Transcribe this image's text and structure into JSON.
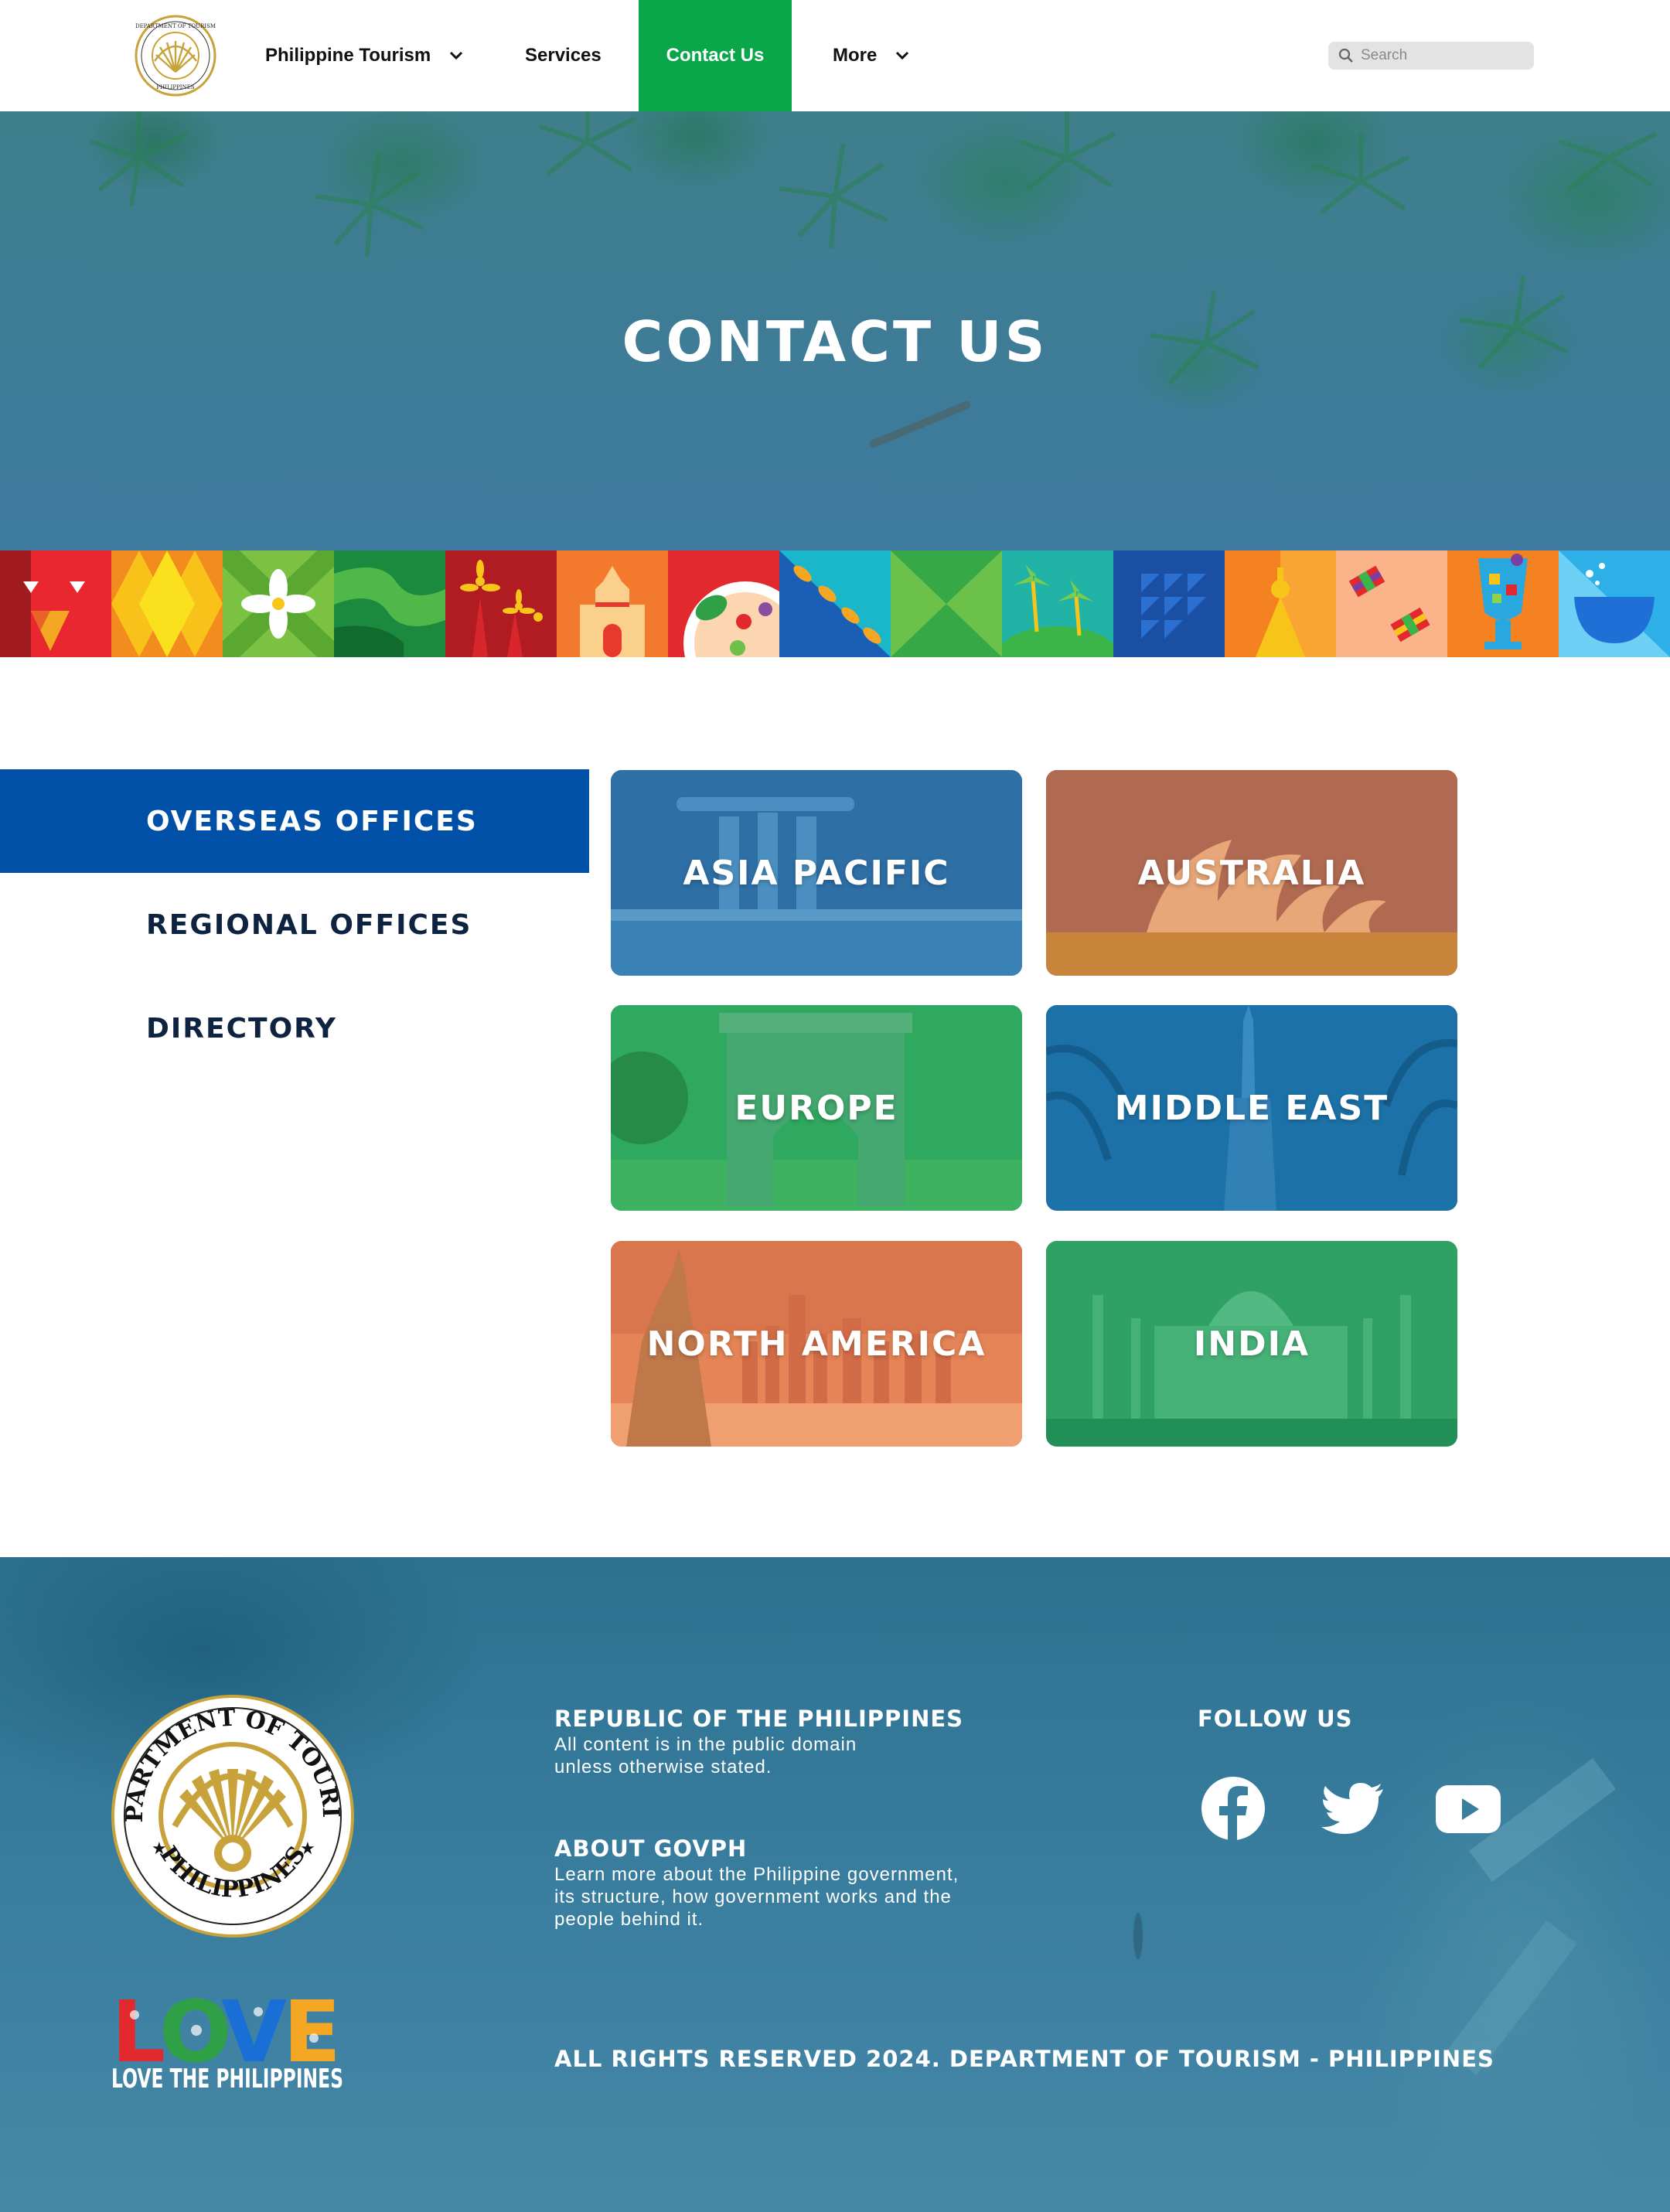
{
  "nav": {
    "logo_text": "DEPARTMENT OF TOURISM PHILIPPINES",
    "items": [
      {
        "label": "Philippine Tourism",
        "has_dropdown": true
      },
      {
        "label": "Services",
        "has_dropdown": false
      },
      {
        "label": "Contact Us",
        "has_dropdown": false,
        "active": true
      },
      {
        "label": "More",
        "has_dropdown": true
      }
    ],
    "search_placeholder": "Search"
  },
  "hero": {
    "title": "CONTACT US"
  },
  "offices": {
    "sidebar": [
      {
        "label": "OVERSEAS OFFICES",
        "active": true
      },
      {
        "label": "REGIONAL OFFICES",
        "active": false
      },
      {
        "label": "DIRECTORY",
        "active": false
      }
    ],
    "regions": [
      {
        "label": "ASIA PACIFIC",
        "color": "#2e6fa6"
      },
      {
        "label": "AUSTRALIA",
        "color": "#b06a52"
      },
      {
        "label": "EUROPE",
        "color": "#2fa860"
      },
      {
        "label": "MIDDLE EAST",
        "color": "#1c72a8"
      },
      {
        "label": "NORTH AMERICA",
        "color": "#e58557"
      },
      {
        "label": "INDIA",
        "color": "#2fa263"
      }
    ]
  },
  "footer": {
    "seal_text": "DEPARTMENT OF TOURISM",
    "seal_subtext": "PHILIPPINES",
    "love_logo_text": "LOVE THE PHILIPPINES",
    "republic_heading": "REPUBLIC OF THE PHILIPPINES",
    "republic_text_1": "All content is in the public domain",
    "republic_text_2": "unless otherwise stated.",
    "about_heading": "ABOUT GOVPH",
    "about_text_1": "Learn more about the Philippine government,",
    "about_text_2": "its structure, how government works and the",
    "about_text_3": "people behind it.",
    "follow_heading": "FOLLOW US",
    "social": [
      "facebook-icon",
      "twitter-icon",
      "youtube-icon"
    ],
    "copyright": "ALL RIGHTS RESERVED 2024. DEPARTMENT OF TOURISM - PHILIPPINES"
  },
  "colors": {
    "accent_green": "#0aa64a",
    "sidebar_blue": "#0050a8",
    "footer_teal": "#2d7291"
  }
}
